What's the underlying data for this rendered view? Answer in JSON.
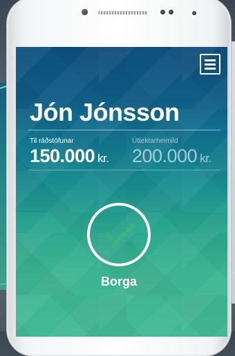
{
  "account": {
    "name": "Jón Jónsson"
  },
  "stats": {
    "available": {
      "label": "Til ráðstöfunar",
      "value": "150.000",
      "currency": "kr."
    },
    "limit": {
      "label": "Úttektarheimild",
      "value": "200.000",
      "currency": "kr."
    }
  },
  "actions": {
    "pay_label": "Borga"
  },
  "icons": {
    "menu": "hamburger-menu-icon",
    "pay": "checkmark-icon"
  },
  "colors": {
    "screen_top": "#0e4f7e",
    "screen_bottom": "#44b994",
    "check": "#3db37f"
  }
}
